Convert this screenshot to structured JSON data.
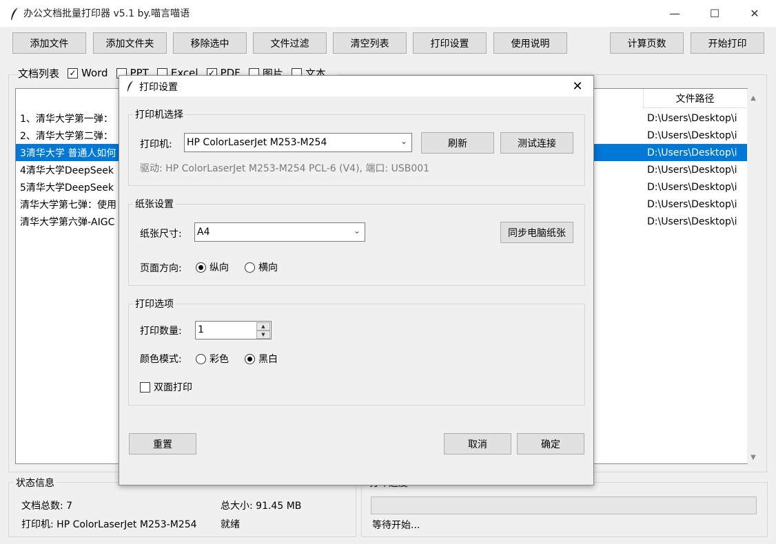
{
  "window": {
    "title": "办公文档批量打印器 v5.1 by.喵言喵语",
    "minimize": "—",
    "maximize": "☐",
    "close": "✕"
  },
  "toolbar": {
    "add_file": "添加文件",
    "add_folder": "添加文件夹",
    "remove_selected": "移除选中",
    "file_filter": "文件过滤",
    "clear_list": "清空列表",
    "print_settings": "打印设置",
    "usage": "使用说明",
    "count_pages": "计算页数",
    "start_print": "开始打印"
  },
  "filters": {
    "label": "文档列表",
    "items": [
      {
        "label": "Word",
        "checked": true
      },
      {
        "label": "PPT",
        "checked": false
      },
      {
        "label": "Excel",
        "checked": false
      },
      {
        "label": "PDF",
        "checked": true
      },
      {
        "label": "图片",
        "checked": false
      },
      {
        "label": "文本",
        "checked": false
      }
    ]
  },
  "file_list": {
    "path_header": "文件路径",
    "rows": [
      {
        "name": "1、清华大学第一弹：",
        "path": "D:\\Users\\Desktop\\i",
        "selected": false
      },
      {
        "name": "2、清华大学第二弹：",
        "path": "D:\\Users\\Desktop\\i",
        "selected": false
      },
      {
        "name": "3清华大学 普通人如何",
        "path": "D:\\Users\\Desktop\\i",
        "selected": true
      },
      {
        "name": "4清华大学DeepSeek",
        "path": "D:\\Users\\Desktop\\i",
        "selected": false
      },
      {
        "name": "5清华大学DeepSeek",
        "path": "D:\\Users\\Desktop\\i",
        "selected": false
      },
      {
        "name": "清华大学第七弹：使用",
        "path": "D:\\Users\\Desktop\\i",
        "selected": false
      },
      {
        "name": "清华大学第六弹-AIGC",
        "path": "D:\\Users\\Desktop\\i",
        "selected": false
      }
    ]
  },
  "status": {
    "group_label": "状态信息",
    "doc_count": "文档总数: 7",
    "total_size": "总大小: 91.45 MB",
    "printer": "打印机: HP ColorLaserJet M253-M254",
    "state": "就绪"
  },
  "progress": {
    "group_label": "打印进度",
    "text": "等待开始...",
    "value": 0
  },
  "dialog": {
    "title": "打印设置",
    "close": "✕",
    "printer_section": {
      "label": "打印机选择",
      "printer_label": "打印机:",
      "printer_value": "HP ColorLaserJet M253-M254",
      "refresh": "刷新",
      "test_connection": "测试连接",
      "driver_info": "驱动: HP ColorLaserJet M253-M254 PCL-6 (V4), 端口: USB001"
    },
    "paper_section": {
      "label": "纸张设置",
      "size_label": "纸张尺寸:",
      "size_value": "A4",
      "sync_button": "同步电脑纸张",
      "orientation_label": "页面方向:",
      "portrait": "纵向",
      "landscape": "横向",
      "orientation_selected": "portrait"
    },
    "print_section": {
      "label": "打印选项",
      "copies_label": "打印数量:",
      "copies_value": "1",
      "color_label": "颜色模式:",
      "color": "彩色",
      "bw": "黑白",
      "color_selected": "bw",
      "duplex_label": "双面打印",
      "duplex_checked": false
    },
    "buttons": {
      "reset": "重置",
      "cancel": "取消",
      "ok": "确定"
    }
  }
}
